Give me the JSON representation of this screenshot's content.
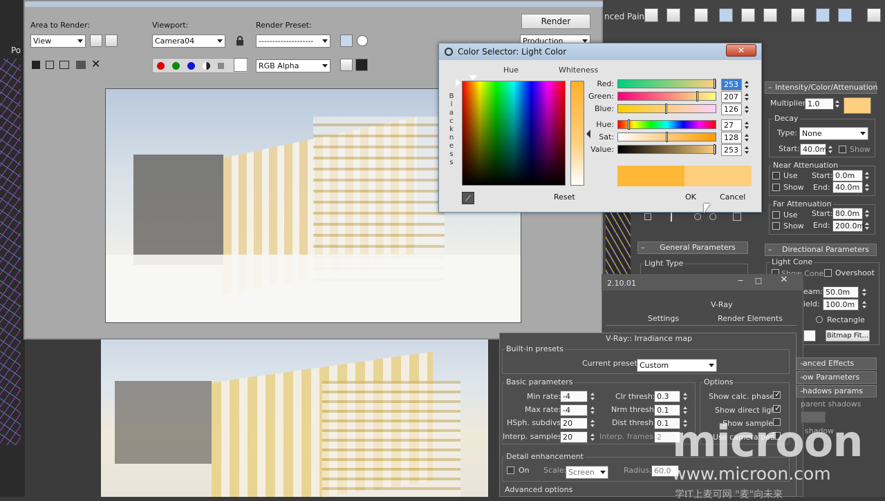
{
  "frame_window": {
    "area_to_render_label": "Area to Render:",
    "area_to_render_value": "View",
    "viewport_label": "Viewport:",
    "viewport_value": "Camera04",
    "render_preset_label": "Render Preset:",
    "render_preset_value": "--------------------",
    "render_button": "Render",
    "render_mode_value": "Production",
    "channel_value": "RGB Alpha"
  },
  "top_toolbar": {
    "enhanced_paint_partial": "nced Paint"
  },
  "left_tab_partial": "Po",
  "color_selector": {
    "title": "Color Selector: Light Color",
    "hue_header": "Hue",
    "whiteness_header": "Whiteness",
    "blackness_letters": [
      "B",
      "l",
      "a",
      "c",
      "k",
      "n",
      "e",
      "s",
      "s"
    ],
    "channels": [
      {
        "label": "Red:",
        "value": "253"
      },
      {
        "label": "Green:",
        "value": "207"
      },
      {
        "label": "Blue:",
        "value": "126"
      },
      {
        "label": "Hue:",
        "value": "27"
      },
      {
        "label": "Sat:",
        "value": "128"
      },
      {
        "label": "Value:",
        "value": "253"
      }
    ],
    "swatch_color": "#FDCF7E",
    "swatch_previous": "#FFB738",
    "reset_button": "Reset",
    "ok_button": "OK",
    "cancel_button": "Cancel"
  },
  "light_panel": {
    "rollout_title": "Intensity/Color/Attenuation",
    "multiplier_label": "Multiplier:",
    "multiplier_value": "1.0",
    "light_color": "#FDCF7E",
    "decay_label": "Decay",
    "type_label": "Type:",
    "type_value": "None",
    "start_label": "Start:",
    "decay_start_value": "40.0m",
    "show_label": "Show",
    "near_atten_label": "Near Attenuation",
    "use_label": "Use",
    "near_start_value": "0.0m",
    "end_label": "End:",
    "near_end_value": "40.0m",
    "far_atten_label": "Far Attenuation",
    "far_start_value": "80.0m",
    "far_end_value": "200.0m",
    "directional_title": "Directional Parameters",
    "light_cone_label": "Light Cone",
    "show_cone_label": "Show Cone",
    "overshoot_label": "Overshoot",
    "hotspot_label_partial": "eam:",
    "hotspot_value": "50.0m",
    "falloff_label_partial": "ield:",
    "falloff_value": "100.0m",
    "rectangle_label": "Rectangle",
    "bitmap_fit_label": "Bitmap Fit...",
    "advanced_effects_label": "anced Effects",
    "shadow_params_label": "ow Parameters",
    "shadows_params_label": "hadows params",
    "transparent_shadows_label": "parent shadows",
    "shadow_partial_label": "shadow"
  },
  "general_params": {
    "title": "General Parameters",
    "light_type_label": "Light Type"
  },
  "render_setup": {
    "title_partial": "2.10.01",
    "tab_vray": "V-Ray",
    "tab_settings": "Settings",
    "tab_render_elements": "Render Elements",
    "rollout_title": "V-Ray:: Irradiance map",
    "builtin_presets_label": "Built-in presets",
    "current_preset_label": "Current preset:",
    "current_preset_value": "Custom",
    "basic_params_label": "Basic parameters",
    "options_label": "Options",
    "min_rate_label": "Min rate:",
    "min_rate_value": "-4",
    "max_rate_label": "Max rate:",
    "max_rate_value": "-4",
    "hsph_label": "HSph. subdivs:",
    "hsph_value": "20",
    "interp_samples_label": "Interp. samples:",
    "interp_samples_value": "20",
    "clr_thresh_label": "Clr thresh:",
    "clr_thresh_value": "0.3",
    "nrm_thresh_label": "Nrm thresh:",
    "nrm_thresh_value": "0.1",
    "dist_thresh_label": "Dist thresh:",
    "dist_thresh_value": "0.1",
    "interp_frames_label": "Interp. frames:",
    "interp_frames_value": "2",
    "show_calc_phase_label": "Show calc. phase",
    "show_direct_light_label": "Show direct light",
    "show_samples_label": "Show samples",
    "use_camera_path_label": "Use camera path",
    "detail_enh_label": "Detail enhancement",
    "on_label": "On",
    "scale_label": "Scale:",
    "scale_value": "Screen",
    "radius_label": "Radius:",
    "radius_value": "60.0",
    "advanced_options_label": "Advanced options"
  },
  "watermark": {
    "logo": "microon",
    "url": "www.microon.com",
    "footer_partial": "学IT上麦可网  \"麦\"向未来"
  }
}
